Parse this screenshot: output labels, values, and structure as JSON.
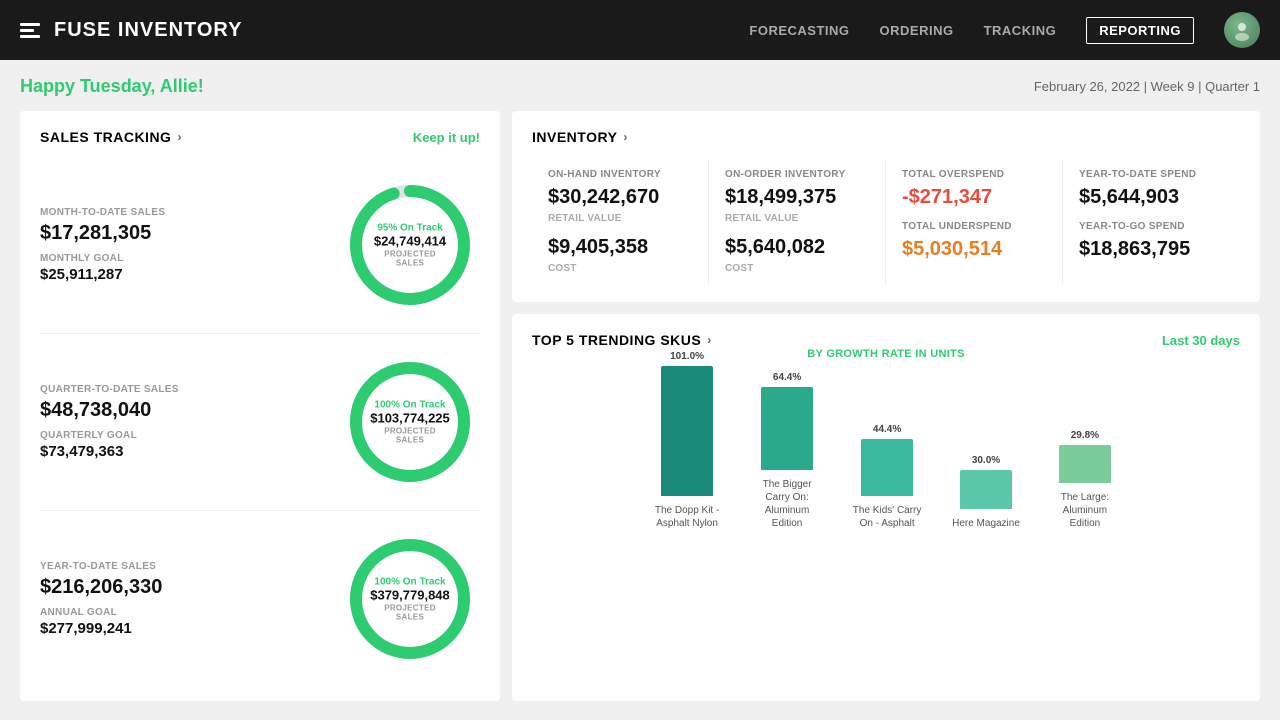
{
  "header": {
    "title": "FUSE INVENTORY",
    "nav": [
      {
        "label": "FORECASTING",
        "active": false
      },
      {
        "label": "ORDERING",
        "active": false
      },
      {
        "label": "TRACKING",
        "active": false
      },
      {
        "label": "REPORTING",
        "active": true
      }
    ]
  },
  "greeting": {
    "text": "Happy Tuesday, Allie!",
    "date": "February 26, 2022  |  Week 9  |  Quarter 1"
  },
  "sales_tracking": {
    "title": "SALES TRACKING",
    "link": "Keep it up!",
    "rows": [
      {
        "period_label": "MONTH-TO-DATE SALES",
        "period_value": "$17,281,305",
        "goal_label": "MONTHLY GOAL",
        "goal_value": "$25,911,287",
        "percent": 95,
        "on_track": "95% On Track",
        "projected": "$24,749,414",
        "projected_label": "PROJECTED SALES",
        "stroke_pct": 95
      },
      {
        "period_label": "QUARTER-TO-DATE SALES",
        "period_value": "$48,738,040",
        "goal_label": "QUARTERLY GOAL",
        "goal_value": "$73,479,363",
        "percent": 100,
        "on_track": "100% On Track",
        "projected": "$103,774,225",
        "projected_label": "PROJECTED SALES",
        "stroke_pct": 100
      },
      {
        "period_label": "YEAR-TO-DATE SALES",
        "period_value": "$216,206,330",
        "goal_label": "ANNUAL GOAL",
        "goal_value": "$277,999,241",
        "percent": 100,
        "on_track": "100% On Track",
        "projected": "$379,779,848",
        "projected_label": "PROJECTED SALES",
        "stroke_pct": 100
      }
    ]
  },
  "inventory": {
    "title": "INVENTORY",
    "cells": [
      {
        "label": "ON-HAND INVENTORY",
        "value": "$30,242,670",
        "sub": "RETAIL VALUE",
        "value2": "$9,405,358",
        "sub2": "COST",
        "red": false
      },
      {
        "label": "ON-ORDER INVENTORY",
        "value": "$18,499,375",
        "sub": "RETAIL VALUE",
        "value2": "$5,640,082",
        "sub2": "COST",
        "red": false
      },
      {
        "label": "TOTAL OVERSPEND",
        "value": "-$271,347",
        "sub": "",
        "label2": "TOTAL UNDERSPEND",
        "value2": "$5,030,514",
        "sub2": "",
        "red": true,
        "red2": true
      },
      {
        "label": "YEAR-TO-DATE SPEND",
        "value": "$5,644,903",
        "sub": "",
        "label2": "YEAR-TO-GO SPEND",
        "value2": "$18,863,795",
        "sub2": "",
        "red": false,
        "red2": false
      }
    ]
  },
  "trending": {
    "title": "TOP 5 TRENDING SKUS",
    "filter": "Last 30 days",
    "subtitle": "BY GROWTH RATE IN UNITS",
    "bars": [
      {
        "label": "The Dopp Kit - Asphalt Nylon",
        "pct": "101.0%",
        "value": 101,
        "color": "#1a8a7a"
      },
      {
        "label": "The Bigger Carry On: Aluminum Edition",
        "pct": "64.4%",
        "value": 64.4,
        "color": "#2aaa8a"
      },
      {
        "label": "The Kids' Carry On - Asphalt",
        "pct": "44.4%",
        "value": 44.4,
        "color": "#3abba0"
      },
      {
        "label": "Here Magazine",
        "pct": "30.0%",
        "value": 30,
        "color": "#5ac8a8"
      },
      {
        "label": "The Large: Aluminum Edition",
        "pct": "29.8%",
        "value": 29.8,
        "color": "#7acc9a"
      }
    ]
  }
}
